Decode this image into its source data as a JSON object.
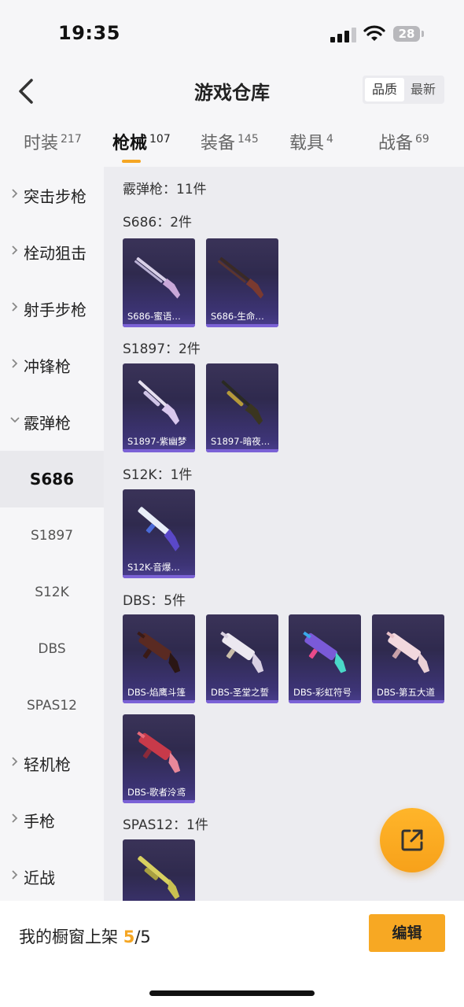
{
  "status_bar": {
    "time": "19:35",
    "battery": "28"
  },
  "header": {
    "title": "游戏仓库",
    "sort_quality": "品质",
    "sort_newest": "最新"
  },
  "tabs": [
    {
      "label": "时装",
      "count": "217"
    },
    {
      "label": "枪械",
      "count": "107"
    },
    {
      "label": "装备",
      "count": "145"
    },
    {
      "label": "载具",
      "count": "4"
    },
    {
      "label": "战备",
      "count": "69"
    }
  ],
  "sidebar": {
    "categories": [
      "突击步枪",
      "栓动狙击",
      "射手步枪",
      "冲锋枪",
      "霰弹枪"
    ],
    "subitems": [
      "S686",
      "S1897",
      "S12K",
      "DBS",
      "SPAS12"
    ],
    "categories_after": [
      "轻机枪",
      "手枪",
      "近战"
    ]
  },
  "content": {
    "category_summary": "霰弹枪：11件",
    "groups": [
      {
        "title": "S686：2件",
        "items": [
          "S686-蜜语…",
          "S686-生命…"
        ]
      },
      {
        "title": "S1897：2件",
        "items": [
          "S1897-紫幽梦",
          "S1897-暗夜…"
        ]
      },
      {
        "title": "S12K：1件",
        "items": [
          "S12K-音爆…"
        ]
      },
      {
        "title": "DBS：5件",
        "items": [
          "DBS-焰鹰斗篷",
          "DBS-圣堂之誓",
          "DBS-彩虹符号",
          "DBS-第五大道",
          "DBS-歌者泠鸢"
        ]
      },
      {
        "title": "SPAS12：1件",
        "items": [
          ""
        ]
      }
    ]
  },
  "bottom": {
    "shelf_label": "我的橱窗上架",
    "shelf_current": "5",
    "shelf_total": "/5",
    "edit_label": "编辑"
  },
  "colors": {
    "accent": "#f5a623",
    "card_bg": "#2f2a4e",
    "card_bar": "#7b62d6"
  },
  "icons": [
    "back-icon",
    "share-icon",
    "chevron-right-icon",
    "chevron-down-icon"
  ]
}
